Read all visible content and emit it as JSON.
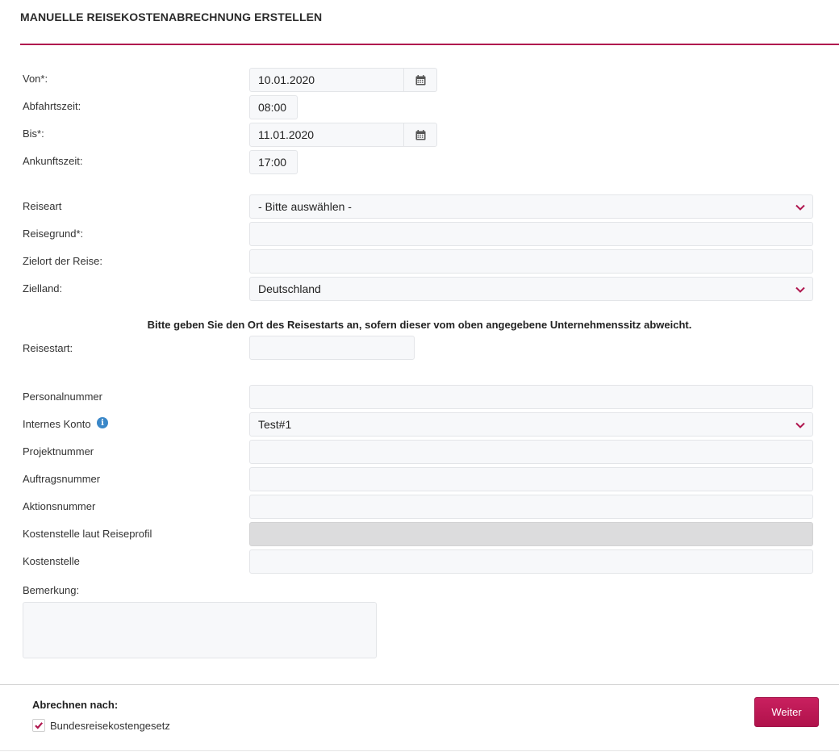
{
  "header": {
    "title": "MANUELLE REISEKOSTENABRECHNUNG ERSTELLEN"
  },
  "colors": {
    "accent": "#b0174f",
    "button": "#c2185b",
    "info": "#3a87c8"
  },
  "form": {
    "von": {
      "label": "Von*:",
      "value": "10.01.2020",
      "icon": "calendar-icon"
    },
    "abfahrtszeit": {
      "label": "Abfahrtszeit:",
      "value": "08:00"
    },
    "bis": {
      "label": "Bis*:",
      "value": "11.01.2020",
      "icon": "calendar-icon"
    },
    "ankunftszeit": {
      "label": "Ankunftszeit:",
      "value": "17:00"
    },
    "reiseart": {
      "label": "Reiseart",
      "value": "- Bitte auswählen -"
    },
    "reisegrund": {
      "label": "Reisegrund*:",
      "value": ""
    },
    "zielort": {
      "label": "Zielort der Reise:",
      "value": ""
    },
    "zielland": {
      "label": "Zielland:",
      "value": "Deutschland"
    },
    "notice": "Bitte geben Sie den Ort des Reisestarts an, sofern dieser vom oben angegebene Unternehmenssitz abweicht.",
    "reisestart": {
      "label": "Reisestart:",
      "value": ""
    },
    "personalnummer": {
      "label": "Personalnummer",
      "value": ""
    },
    "internes_konto": {
      "label": "Internes Konto",
      "value": "Test#1",
      "icon": "info-icon"
    },
    "projektnummer": {
      "label": "Projektnummer",
      "value": ""
    },
    "auftragsnummer": {
      "label": "Auftragsnummer",
      "value": ""
    },
    "aktionsnummer": {
      "label": "Aktionsnummer",
      "value": ""
    },
    "kostenstelle_profil": {
      "label": "Kostenstelle laut Reiseprofil",
      "value": ""
    },
    "kostenstelle": {
      "label": "Kostenstelle",
      "value": ""
    },
    "bemerkung": {
      "label": "Bemerkung:",
      "value": ""
    }
  },
  "footer": {
    "title": "Abrechnen nach:",
    "checkbox_label": "Bundesreisekostengesetz",
    "checkbox_checked": true,
    "weiter_label": "Weiter"
  }
}
